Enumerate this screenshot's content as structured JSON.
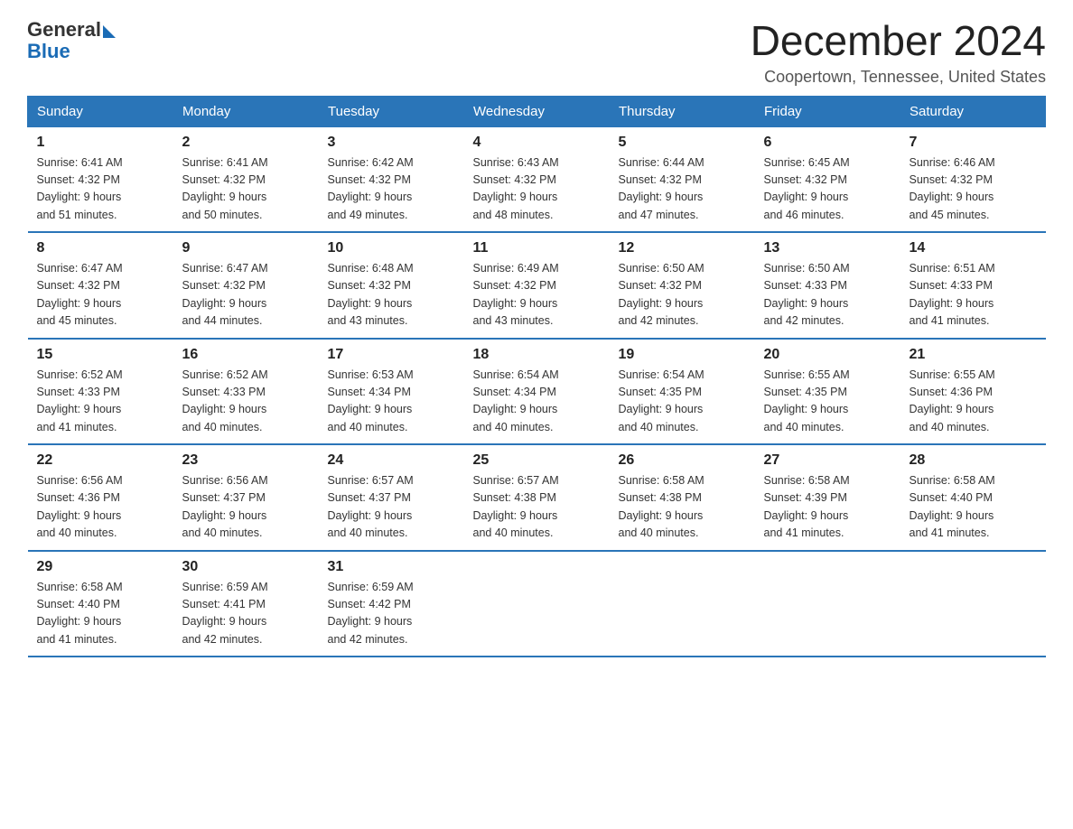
{
  "header": {
    "logo_general": "General",
    "logo_blue": "Blue",
    "title": "December 2024",
    "subtitle": "Coopertown, Tennessee, United States"
  },
  "weekdays": [
    "Sunday",
    "Monday",
    "Tuesday",
    "Wednesday",
    "Thursday",
    "Friday",
    "Saturday"
  ],
  "weeks": [
    [
      {
        "day": "1",
        "info": "Sunrise: 6:41 AM\nSunset: 4:32 PM\nDaylight: 9 hours\nand 51 minutes."
      },
      {
        "day": "2",
        "info": "Sunrise: 6:41 AM\nSunset: 4:32 PM\nDaylight: 9 hours\nand 50 minutes."
      },
      {
        "day": "3",
        "info": "Sunrise: 6:42 AM\nSunset: 4:32 PM\nDaylight: 9 hours\nand 49 minutes."
      },
      {
        "day": "4",
        "info": "Sunrise: 6:43 AM\nSunset: 4:32 PM\nDaylight: 9 hours\nand 48 minutes."
      },
      {
        "day": "5",
        "info": "Sunrise: 6:44 AM\nSunset: 4:32 PM\nDaylight: 9 hours\nand 47 minutes."
      },
      {
        "day": "6",
        "info": "Sunrise: 6:45 AM\nSunset: 4:32 PM\nDaylight: 9 hours\nand 46 minutes."
      },
      {
        "day": "7",
        "info": "Sunrise: 6:46 AM\nSunset: 4:32 PM\nDaylight: 9 hours\nand 45 minutes."
      }
    ],
    [
      {
        "day": "8",
        "info": "Sunrise: 6:47 AM\nSunset: 4:32 PM\nDaylight: 9 hours\nand 45 minutes."
      },
      {
        "day": "9",
        "info": "Sunrise: 6:47 AM\nSunset: 4:32 PM\nDaylight: 9 hours\nand 44 minutes."
      },
      {
        "day": "10",
        "info": "Sunrise: 6:48 AM\nSunset: 4:32 PM\nDaylight: 9 hours\nand 43 minutes."
      },
      {
        "day": "11",
        "info": "Sunrise: 6:49 AM\nSunset: 4:32 PM\nDaylight: 9 hours\nand 43 minutes."
      },
      {
        "day": "12",
        "info": "Sunrise: 6:50 AM\nSunset: 4:32 PM\nDaylight: 9 hours\nand 42 minutes."
      },
      {
        "day": "13",
        "info": "Sunrise: 6:50 AM\nSunset: 4:33 PM\nDaylight: 9 hours\nand 42 minutes."
      },
      {
        "day": "14",
        "info": "Sunrise: 6:51 AM\nSunset: 4:33 PM\nDaylight: 9 hours\nand 41 minutes."
      }
    ],
    [
      {
        "day": "15",
        "info": "Sunrise: 6:52 AM\nSunset: 4:33 PM\nDaylight: 9 hours\nand 41 minutes."
      },
      {
        "day": "16",
        "info": "Sunrise: 6:52 AM\nSunset: 4:33 PM\nDaylight: 9 hours\nand 40 minutes."
      },
      {
        "day": "17",
        "info": "Sunrise: 6:53 AM\nSunset: 4:34 PM\nDaylight: 9 hours\nand 40 minutes."
      },
      {
        "day": "18",
        "info": "Sunrise: 6:54 AM\nSunset: 4:34 PM\nDaylight: 9 hours\nand 40 minutes."
      },
      {
        "day": "19",
        "info": "Sunrise: 6:54 AM\nSunset: 4:35 PM\nDaylight: 9 hours\nand 40 minutes."
      },
      {
        "day": "20",
        "info": "Sunrise: 6:55 AM\nSunset: 4:35 PM\nDaylight: 9 hours\nand 40 minutes."
      },
      {
        "day": "21",
        "info": "Sunrise: 6:55 AM\nSunset: 4:36 PM\nDaylight: 9 hours\nand 40 minutes."
      }
    ],
    [
      {
        "day": "22",
        "info": "Sunrise: 6:56 AM\nSunset: 4:36 PM\nDaylight: 9 hours\nand 40 minutes."
      },
      {
        "day": "23",
        "info": "Sunrise: 6:56 AM\nSunset: 4:37 PM\nDaylight: 9 hours\nand 40 minutes."
      },
      {
        "day": "24",
        "info": "Sunrise: 6:57 AM\nSunset: 4:37 PM\nDaylight: 9 hours\nand 40 minutes."
      },
      {
        "day": "25",
        "info": "Sunrise: 6:57 AM\nSunset: 4:38 PM\nDaylight: 9 hours\nand 40 minutes."
      },
      {
        "day": "26",
        "info": "Sunrise: 6:58 AM\nSunset: 4:38 PM\nDaylight: 9 hours\nand 40 minutes."
      },
      {
        "day": "27",
        "info": "Sunrise: 6:58 AM\nSunset: 4:39 PM\nDaylight: 9 hours\nand 41 minutes."
      },
      {
        "day": "28",
        "info": "Sunrise: 6:58 AM\nSunset: 4:40 PM\nDaylight: 9 hours\nand 41 minutes."
      }
    ],
    [
      {
        "day": "29",
        "info": "Sunrise: 6:58 AM\nSunset: 4:40 PM\nDaylight: 9 hours\nand 41 minutes."
      },
      {
        "day": "30",
        "info": "Sunrise: 6:59 AM\nSunset: 4:41 PM\nDaylight: 9 hours\nand 42 minutes."
      },
      {
        "day": "31",
        "info": "Sunrise: 6:59 AM\nSunset: 4:42 PM\nDaylight: 9 hours\nand 42 minutes."
      },
      null,
      null,
      null,
      null
    ]
  ]
}
